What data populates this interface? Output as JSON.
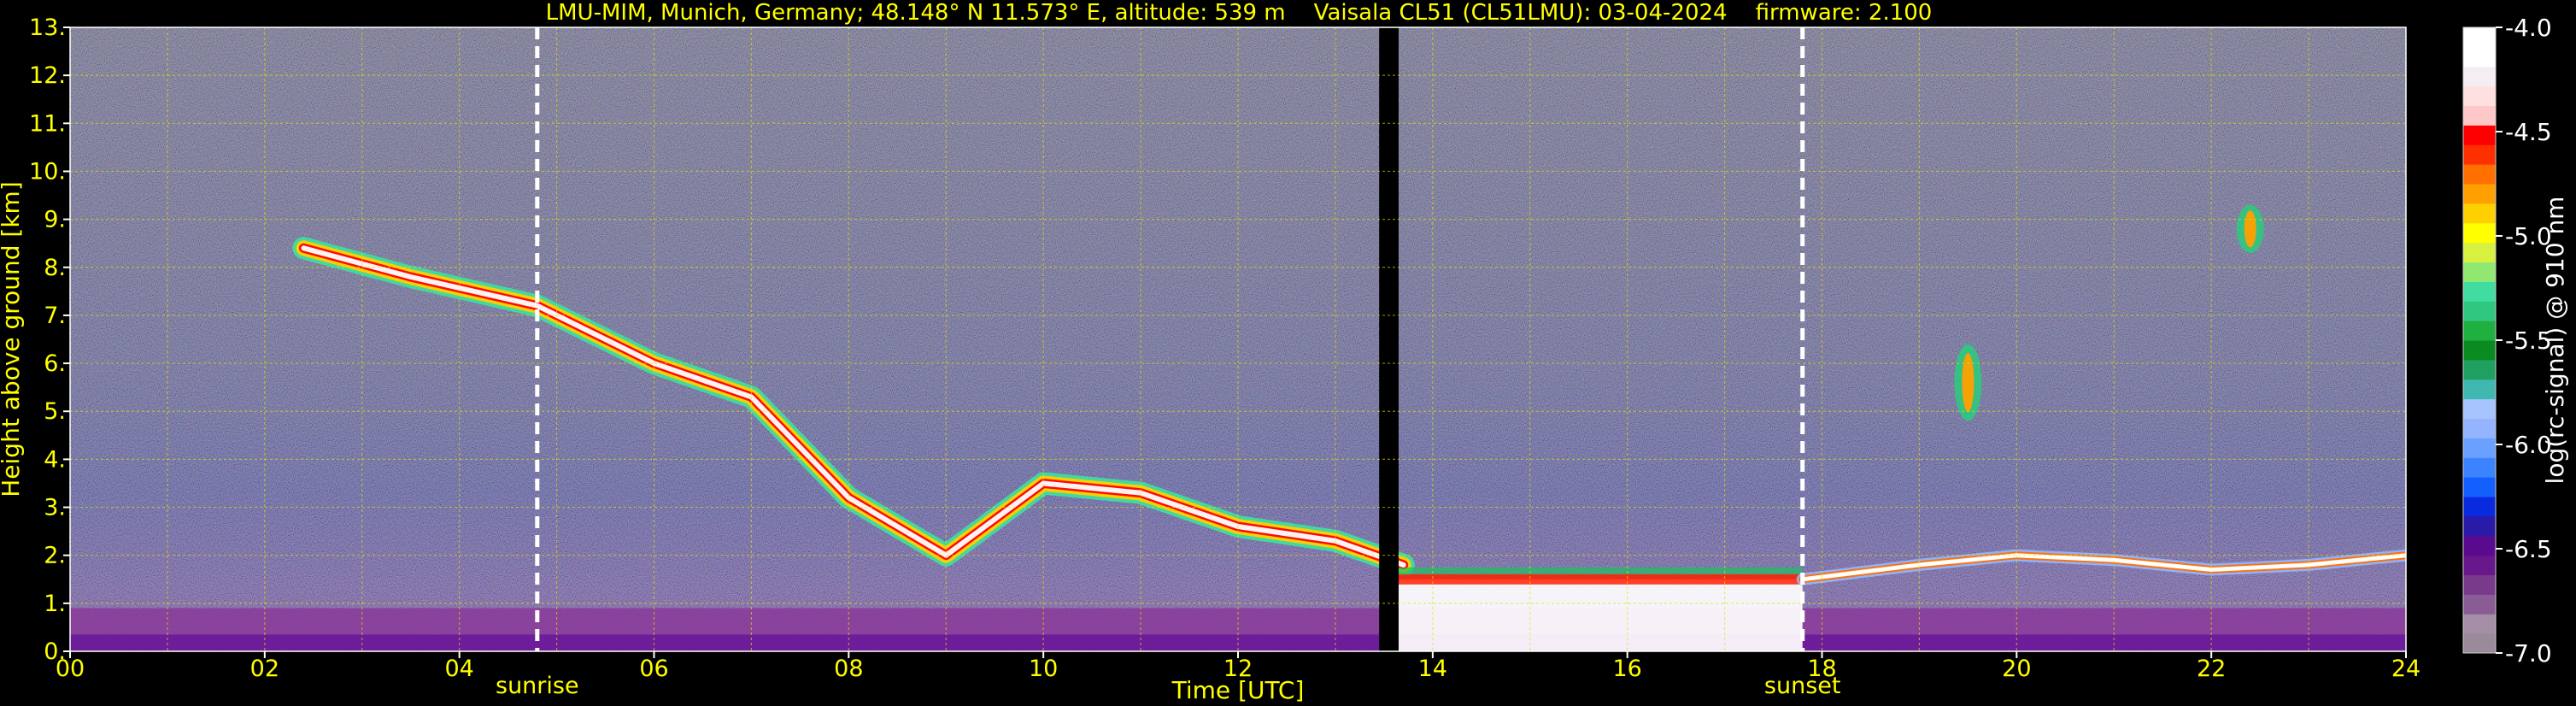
{
  "header": {
    "title": "LMU-MIM, Munich, Germany; 48.148° N 11.573° E, altitude: 539 m    Vaisala CL51 (CL51LMU): 03-04-2024    firmware: 2.100"
  },
  "chart_data": {
    "type": "heatmap",
    "xlabel": "Time [UTC]",
    "ylabel": "Height above ground [km]",
    "xlim": [
      0,
      24
    ],
    "ylim": [
      0,
      13
    ],
    "x_ticks": [
      "00",
      "02",
      "04",
      "06",
      "08",
      "10",
      "12",
      "14",
      "16",
      "18",
      "20",
      "22",
      "24"
    ],
    "y_ticks": [
      "0.",
      "1.",
      "2.",
      "3.",
      "4.",
      "5.",
      "6.",
      "7.",
      "8.",
      "9.",
      "10.",
      "11.",
      "12.",
      "13."
    ],
    "grid": true,
    "events": [
      {
        "label": "sunrise",
        "time": 4.8
      },
      {
        "label": "sunset",
        "time": 17.8
      }
    ],
    "colorbar": {
      "label": "log(rc-signal) @ 910 nm",
      "ticks": [
        "-4.0",
        "-4.5",
        "-5.0",
        "-5.5",
        "-6.0",
        "-6.5",
        "-7.0"
      ],
      "range": [
        -7.0,
        -4.0
      ],
      "colors": [
        "#9a8a9a",
        "#a48fa6",
        "#8a5c96",
        "#7a3a8c",
        "#68188a",
        "#5a0a8e",
        "#2a1aa8",
        "#0a2ae0",
        "#1460ff",
        "#3c84ff",
        "#6aa0ff",
        "#94b4ff",
        "#a8c4ff",
        "#40b8b0",
        "#20a060",
        "#0a8a20",
        "#20b040",
        "#30c880",
        "#40dca0",
        "#90e870",
        "#d8f040",
        "#ffff00",
        "#ffd000",
        "#ffa000",
        "#ff7000",
        "#ff3000",
        "#ff0000",
        "#ffc8c8",
        "#ffe0e0",
        "#f4eef4",
        "#ffffff",
        "#ffffff"
      ]
    },
    "features": [
      {
        "kind": "boundary_layer",
        "t": [
          0,
          24
        ],
        "h": [
          0.0,
          0.9
        ]
      },
      {
        "kind": "descending_cirrus",
        "points": [
          [
            2.4,
            8.4
          ],
          [
            3.5,
            7.8
          ],
          [
            4.8,
            7.2
          ],
          [
            6.0,
            6.0
          ],
          [
            7.0,
            5.3
          ],
          [
            8.0,
            3.2
          ],
          [
            9.0,
            2.0
          ],
          [
            10.0,
            3.5
          ],
          [
            11.0,
            3.3
          ],
          [
            12.0,
            2.6
          ],
          [
            13.0,
            2.3
          ],
          [
            13.7,
            1.8
          ]
        ]
      },
      {
        "kind": "low_cloud",
        "t": [
          13.6,
          17.8
        ],
        "h": [
          0.0,
          1.5
        ]
      },
      {
        "kind": "cloud_top_layer",
        "points": [
          [
            17.8,
            1.5
          ],
          [
            19.0,
            1.8
          ],
          [
            20.0,
            2.0
          ],
          [
            21.0,
            1.9
          ],
          [
            22.0,
            1.7
          ],
          [
            23.0,
            1.8
          ],
          [
            24.0,
            2.0
          ]
        ]
      },
      {
        "kind": "convective_cell",
        "t": 19.5,
        "h": [
          4.8,
          6.4
        ]
      },
      {
        "kind": "upper_cloud",
        "t": 22.4,
        "h": [
          8.3,
          9.3
        ]
      },
      {
        "kind": "data_gap",
        "t": [
          13.45,
          13.65
        ]
      }
    ]
  }
}
